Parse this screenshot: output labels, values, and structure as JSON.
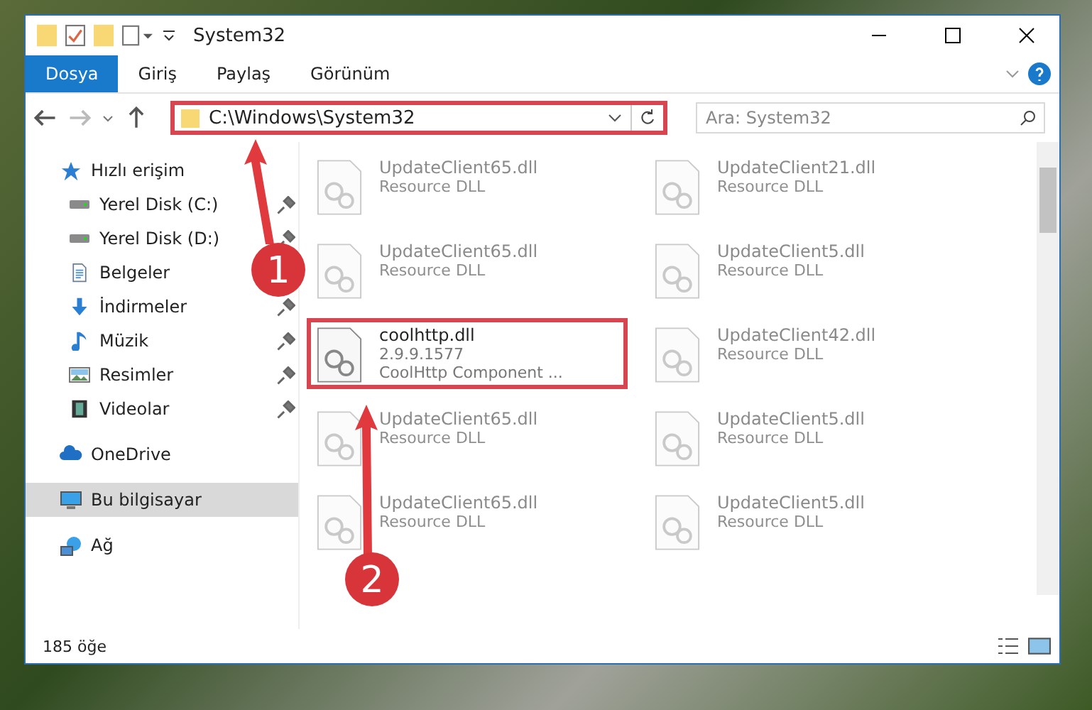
{
  "window": {
    "title": "System32"
  },
  "ribbon_tabs": [
    {
      "label": "Dosya",
      "selected": true
    },
    {
      "label": "Giriş",
      "selected": false
    },
    {
      "label": "Paylaş",
      "selected": false
    },
    {
      "label": "Görünüm",
      "selected": false
    }
  ],
  "address_bar": {
    "value": "C:\\Windows\\System32",
    "highlighted": true
  },
  "search": {
    "placeholder": "Ara: System32"
  },
  "sidebar": {
    "items": [
      {
        "label": "Hızlı erişim",
        "selected": false,
        "children": [
          {
            "label": "Yerel Disk (C:)",
            "pinned": true
          },
          {
            "label": "Yerel Disk (D:)",
            "pinned": true
          },
          {
            "label": "Belgeler"
          },
          {
            "label": "İndirmeler",
            "pinned": true
          },
          {
            "label": "Müzik",
            "pinned": true
          },
          {
            "label": "Resimler",
            "pinned": true
          },
          {
            "label": "Videolar",
            "pinned": true
          }
        ]
      },
      {
        "label": "OneDrive",
        "selected": false
      },
      {
        "label": "Bu bilgisayar",
        "selected": true
      },
      {
        "label": "Ağ",
        "selected": false
      }
    ]
  },
  "files": [
    {
      "name": "UpdateClient65.dll",
      "details": [
        "Resource DLL"
      ],
      "faded": true,
      "highlighted": false
    },
    {
      "name": "UpdateClient21.dll",
      "details": [
        "Resource DLL"
      ],
      "faded": true,
      "highlighted": false
    },
    {
      "name": "UpdateClient65.dll",
      "details": [
        "Resource DLL"
      ],
      "faded": true,
      "highlighted": false
    },
    {
      "name": "UpdateClient5.dll",
      "details": [
        "Resource DLL"
      ],
      "faded": true,
      "highlighted": false
    },
    {
      "name": "coolhttp.dll",
      "details": [
        "2.9.9.1577",
        "CoolHttp Component ..."
      ],
      "faded": false,
      "highlighted": true
    },
    {
      "name": "UpdateClient42.dll",
      "details": [
        "Resource DLL"
      ],
      "faded": true,
      "highlighted": false
    },
    {
      "name": "UpdateClient65.dll",
      "details": [
        "Resource DLL"
      ],
      "faded": true,
      "highlighted": false
    },
    {
      "name": "UpdateClient5.dll",
      "details": [
        "Resource DLL"
      ],
      "faded": true,
      "highlighted": false
    },
    {
      "name": "UpdateClient65.dll",
      "details": [
        "Resource DLL"
      ],
      "faded": true,
      "highlighted": false
    },
    {
      "name": "UpdateClient5.dll",
      "details": [
        "Resource DLL"
      ],
      "faded": true,
      "highlighted": false
    }
  ],
  "status_bar": {
    "count": "185 öğe"
  },
  "annotations": [
    {
      "label": "1"
    },
    {
      "label": "2"
    }
  ]
}
